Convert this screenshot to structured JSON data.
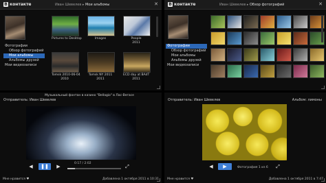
{
  "top_left": {
    "logo_text": "контакте",
    "logo_badge": "B",
    "crumb_owner": "Иван Шевелев",
    "crumb_page": "Мои альбомы",
    "menu": [
      {
        "label": "Фотографии",
        "level": 0,
        "selected": false
      },
      {
        "label": "Обзор фотографий",
        "level": 1,
        "selected": false
      },
      {
        "label": "Мои альбомы",
        "level": 1,
        "selected": true
      },
      {
        "label": "Альбомы друзей",
        "level": 1,
        "selected": false
      },
      {
        "label": "Мои видеозаписи",
        "level": 0,
        "selected": false
      }
    ],
    "albums": [
      {
        "title": "Pictures to Desktop",
        "date": ""
      },
      {
        "title": "Images",
        "date": ""
      },
      {
        "title": "People",
        "date": "2011"
      },
      {
        "title": "Tomsk 2010-06-04",
        "date": "2010"
      },
      {
        "title": "Tomsk NY 2011",
        "date": "2011"
      },
      {
        "title": "ECD day at BAdT",
        "date": "2011"
      }
    ]
  },
  "top_right": {
    "logo_text": "контакте",
    "logo_badge": "B",
    "crumb_owner": "Иван Шевелев",
    "crumb_page": "Обзор фотографий",
    "menu": [
      {
        "label": "Фотографии",
        "level": 0,
        "selected": true
      },
      {
        "label": "Обзор фотографий",
        "level": 1,
        "selected": false
      },
      {
        "label": "Мои альбомы",
        "level": 1,
        "selected": false
      },
      {
        "label": "Альбомы друзей",
        "level": 1,
        "selected": false
      },
      {
        "label": "Мои видеозаписи",
        "level": 0,
        "selected": false
      }
    ]
  },
  "bottom_left": {
    "sender_label": "Отправитель: Иван Шевелев",
    "video_title": "Музыкальный фонтан в казино \"Bellagio\" в Лас-Вегасе",
    "time": "0:17 / 2:02",
    "progress": 0.14,
    "like_label": "Мне нравится",
    "like_count": "",
    "added": "Добавлена 1 октября 2011 в 10:31"
  },
  "bottom_right": {
    "sender_label": "Отправитель: Иван Шевелев",
    "album_label": "Альбом: лимоны",
    "counter": "Фотография 1 из 6",
    "like_label": "Мне нравится",
    "added": "Добавлена 1 октября 2011 в 7:47"
  },
  "icons": {
    "close": "✕",
    "prev": "◀",
    "next": "▶",
    "pause": "❚❚",
    "fullscreen": "⤢",
    "heart": "♥"
  }
}
